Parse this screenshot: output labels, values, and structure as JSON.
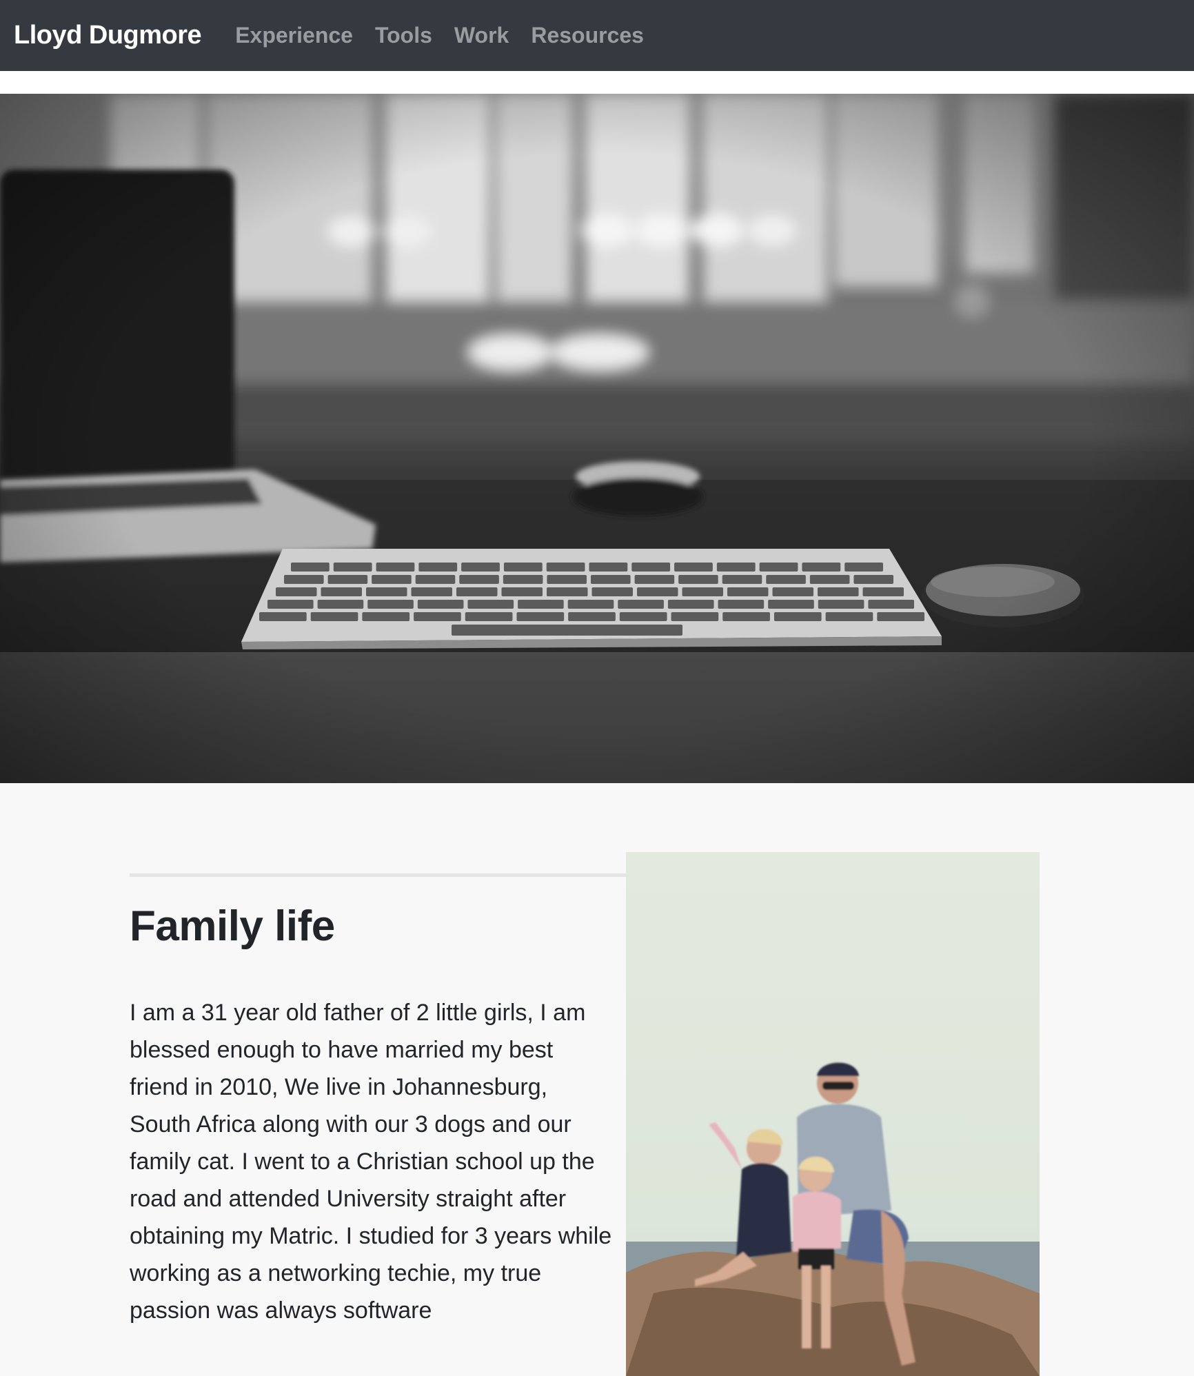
{
  "navbar": {
    "brand": "Lloyd Dugmore",
    "links": [
      {
        "label": "Experience"
      },
      {
        "label": "Tools"
      },
      {
        "label": "Work"
      },
      {
        "label": "Resources"
      }
    ]
  },
  "colors": {
    "navbar_bg": "#343a40",
    "brand_text": "#ffffff",
    "nav_link_text": "rgba(255,255,255,0.5)",
    "page_bg": "#f8f8f8",
    "body_text": "#212529"
  },
  "hero": {
    "image": "desk-keyboard-photo"
  },
  "family_section": {
    "title": "Family life",
    "body": "I am a 31 year old father of 2 little girls, I am blessed enough to have married my best friend in 2010, We live in Johannesburg, South Africa along with our 3 dogs and our family cat. I went to a Christian school up the road and attended University straight after obtaining my Matric. I studied for 3 years while working as a networking techie, my true passion was always software",
    "photo": "family-photo"
  }
}
